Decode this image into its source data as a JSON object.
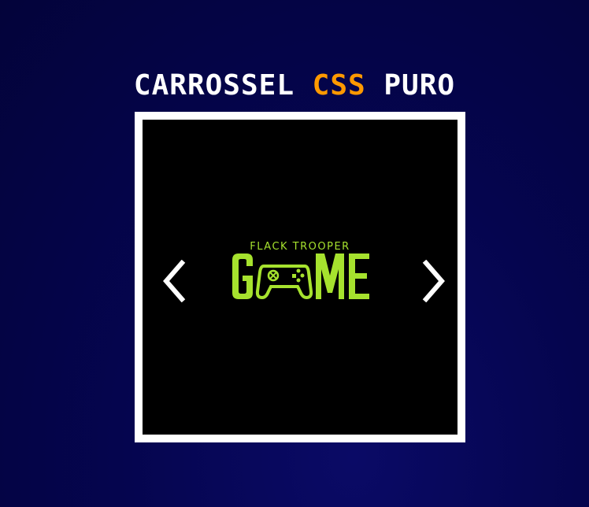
{
  "header": {
    "title_part1": "CARROSSEL ",
    "title_accent": "CSS",
    "title_part2": " PURO"
  },
  "carousel": {
    "slide": {
      "logo_subtitle": "FLACK TROOPER",
      "logo_main": "GAME"
    },
    "prev_icon": "chevron-left-icon",
    "next_icon": "chevron-right-icon"
  },
  "colors": {
    "background": "#05054f",
    "title": "#ffffff",
    "accent": "#ff9900",
    "frame": "#ffffff",
    "logo": "#a6e22e"
  }
}
